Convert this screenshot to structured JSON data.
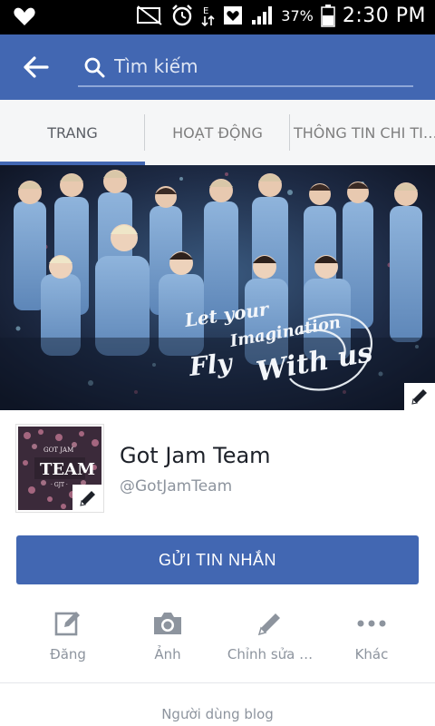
{
  "status_bar": {
    "battery_percent": "37%",
    "time": "2:30 PM"
  },
  "search": {
    "placeholder": "Tìm kiếm"
  },
  "tabs": [
    {
      "label": "TRANG"
    },
    {
      "label": "HOẠT ĐỘNG"
    },
    {
      "label": "THÔNG TIN CHI TI…"
    }
  ],
  "cover": {
    "artwork_text": "Let your Imagination Fly With us"
  },
  "profile": {
    "name": "Got Jam Team",
    "handle": "@GotJamTeam",
    "avatar_text": "TEAM"
  },
  "message_button": {
    "label": "GỬI TIN NHẮN"
  },
  "actions": [
    {
      "label": "Đăng",
      "icon": "compose-icon"
    },
    {
      "label": "Ảnh",
      "icon": "camera-icon"
    },
    {
      "label": "Chỉnh sửa …",
      "icon": "pencil-icon"
    },
    {
      "label": "Khác",
      "icon": "more-icon"
    }
  ],
  "category": "Người dùng blog",
  "colors": {
    "brand_blue": "#4267b2",
    "tab_bg": "#f5f6f7",
    "muted_text": "#8d949e"
  }
}
